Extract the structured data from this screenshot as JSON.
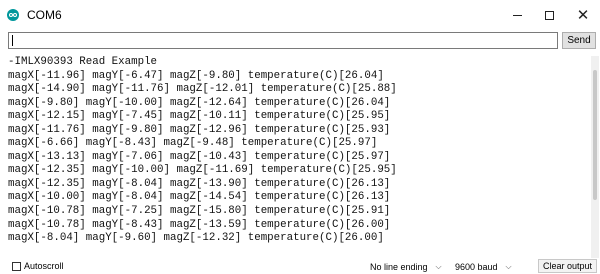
{
  "window": {
    "title": "COM6",
    "minimize_glyph": "",
    "maximize_glyph": "",
    "close_glyph": "✕"
  },
  "send_bar": {
    "input_value": "",
    "send_label": "Send"
  },
  "output": {
    "lines": [
      "-ȈMLX90393 Read Example",
      "magX[-11.96] magY[-6.47] magZ[-9.80] temperature(C)[26.04]",
      "magX[-14.90] magY[-11.76] magZ[-12.01] temperature(C)[25.88]",
      "magX[-9.80] magY[-10.00] magZ[-12.64] temperature(C)[26.04]",
      "magX[-12.15] magY[-7.45] magZ[-10.11] temperature(C)[25.95]",
      "magX[-11.76] magY[-9.80] magZ[-12.96] temperature(C)[25.93]",
      "magX[-6.66] magY[-8.43] magZ[-9.48] temperature(C)[25.97]",
      "magX[-13.13] magY[-7.06] magZ[-10.43] temperature(C)[25.97]",
      "magX[-12.35] magY[-10.00] magZ[-11.69] temperature(C)[25.95]",
      "magX[-12.35] magY[-8.04] magZ[-13.90] temperature(C)[26.13]",
      "magX[-10.00] magY[-8.04] magZ[-14.54] temperature(C)[26.13]",
      "magX[-10.78] magY[-7.25] magZ[-15.80] temperature(C)[25.91]",
      "magX[-10.78] magY[-8.43] magZ[-13.59] temperature(C)[26.00]",
      "magX[-8.04] magY[-9.60] magZ[-12.32] temperature(C)[26.00]"
    ]
  },
  "statusbar": {
    "autoscroll_label": "Autoscroll",
    "autoscroll_checked": false,
    "line_ending": "No line ending",
    "baud_rate": "9600 baud",
    "clear_label": "Clear output"
  },
  "colors": {
    "app_icon": "#00979c"
  }
}
